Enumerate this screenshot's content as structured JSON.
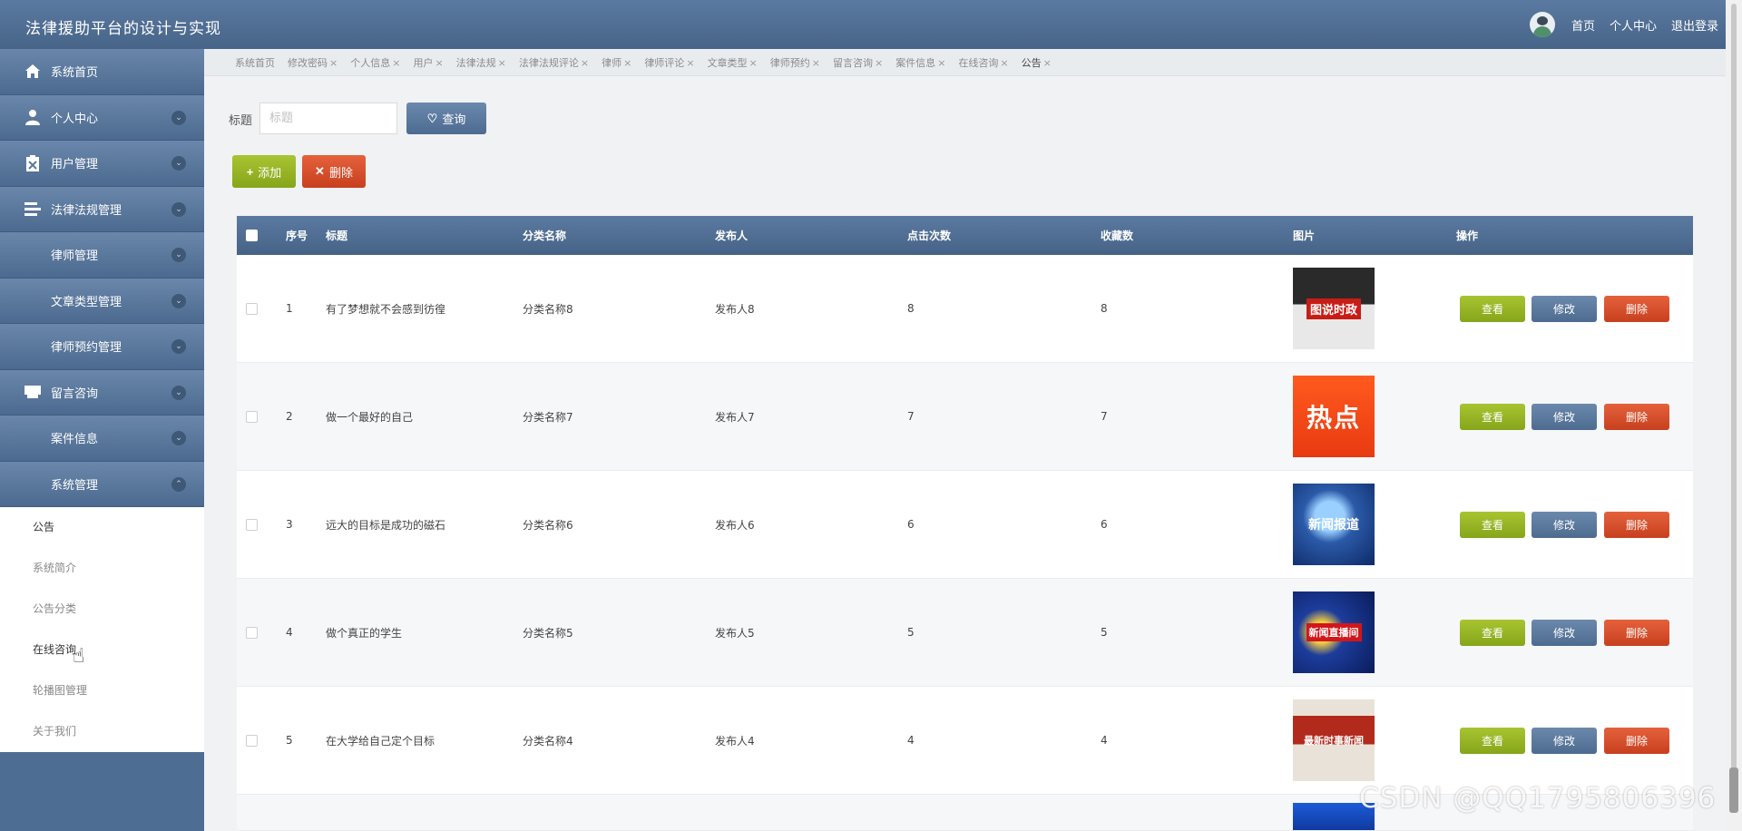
{
  "header": {
    "title": "法律援助平台的设计与实现",
    "links": [
      "首页",
      "个人中心",
      "退出登录"
    ]
  },
  "sidebar": {
    "items": [
      {
        "label": "系统首页",
        "icon": "home-icon",
        "expandable": false
      },
      {
        "label": "个人中心",
        "icon": "user-icon",
        "expandable": true
      },
      {
        "label": "用户管理",
        "icon": "clipboard-icon",
        "expandable": true
      },
      {
        "label": "法律法规管理",
        "icon": "list-icon",
        "expandable": true
      },
      {
        "label": "律师管理",
        "icon": "grid-icon",
        "expandable": true
      },
      {
        "label": "文章类型管理",
        "icon": "grid-icon",
        "expandable": true
      },
      {
        "label": "律师预约管理",
        "icon": "grid-icon",
        "expandable": true
      },
      {
        "label": "留言咨询",
        "icon": "inbox-icon",
        "expandable": true
      },
      {
        "label": "案件信息",
        "icon": "grid-icon",
        "expandable": true
      },
      {
        "label": "系统管理",
        "icon": "grid-icon",
        "expandable": true,
        "expanded": true
      }
    ],
    "submenu": [
      "公告",
      "系统简介",
      "公告分类",
      "在线咨询",
      "轮播图管理",
      "关于我们"
    ]
  },
  "tabs": [
    "系统首页",
    "修改密码",
    "个人信息",
    "用户",
    "法律法规",
    "法律法规评论",
    "律师",
    "律师评论",
    "文章类型",
    "律师预约",
    "留言咨询",
    "案件信息",
    "在线咨询",
    "公告"
  ],
  "search": {
    "label": "标题",
    "placeholder": "标题",
    "button": "查询"
  },
  "toolbar": {
    "add_label": "添加",
    "delete_label": "删除"
  },
  "table": {
    "columns": [
      "序号",
      "标题",
      "分类名称",
      "发布人",
      "点击次数",
      "收藏数",
      "图片",
      "操作"
    ],
    "rows": [
      {
        "index": "1",
        "title": "有了梦想就不会感到彷徨",
        "category": "分类名称8",
        "publisher": "发布人8",
        "clicks": "8",
        "favorites": "8",
        "image_text": "图说时政"
      },
      {
        "index": "2",
        "title": "做一个最好的自己",
        "category": "分类名称7",
        "publisher": "发布人7",
        "clicks": "7",
        "favorites": "7",
        "image_text": "热点"
      },
      {
        "index": "3",
        "title": "远大的目标是成功的磁石",
        "category": "分类名称6",
        "publisher": "发布人6",
        "clicks": "6",
        "favorites": "6",
        "image_text": "新闻报道"
      },
      {
        "index": "4",
        "title": "做个真正的学生",
        "category": "分类名称5",
        "publisher": "发布人5",
        "clicks": "5",
        "favorites": "5",
        "image_text": "新闻直播间"
      },
      {
        "index": "5",
        "title": "在大学给自己定个目标",
        "category": "分类名称4",
        "publisher": "发布人4",
        "clicks": "4",
        "favorites": "4",
        "image_text": "最新时事新闻"
      }
    ],
    "actions": {
      "view": "查看",
      "edit": "修改",
      "delete": "删除"
    }
  },
  "watermark": "CSDN @QQ1795806396"
}
